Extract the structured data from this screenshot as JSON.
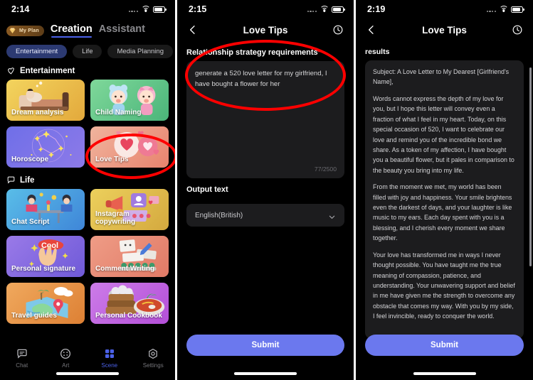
{
  "panel1": {
    "status": {
      "time": "2:14",
      "wifi_icon": "wifi-icon",
      "battery_icon": "battery-icon",
      "signal_icon": "signal-dots-icon"
    },
    "plan_badge": {
      "label": "My Plan",
      "icon": "gem-icon",
      "color": "#8a5a22"
    },
    "nav_tabs": [
      {
        "label": "Creation",
        "active": true
      },
      {
        "label": "Assistant",
        "active": false
      }
    ],
    "pills": [
      {
        "label": "Entertainment",
        "active": true,
        "color": "#2c3a72"
      },
      {
        "label": "Life",
        "active": false
      },
      {
        "label": "Media Planning",
        "active": false
      }
    ],
    "sections": [
      {
        "title": "Entertainment",
        "icon": "heart-outline-icon",
        "cards": [
          {
            "label": "Dream analysis",
            "color": "#e8c84a",
            "art": "sleeping-person-bed-icon"
          },
          {
            "label": "Child Naming",
            "color": "#6bc98a",
            "art": "two-babies-icon"
          },
          {
            "label": "Horoscope",
            "color": "#6b6de0",
            "art": "constellation-icon"
          },
          {
            "label": "Love Tips",
            "color": "#ef9a86",
            "art": "heart-bubbles-icon"
          }
        ]
      },
      {
        "title": "Life",
        "icon": "speech-bubble-icon",
        "cards": [
          {
            "label": "Chat Script",
            "color": "#4aa8dd",
            "art": "two-people-table-icon"
          },
          {
            "label": "Instagram copywriting",
            "color": "#e0c34a",
            "art": "megaphone-social-icon"
          },
          {
            "label": "Personal signature",
            "color": "#8a6be0",
            "art": "cool-hand-icon"
          },
          {
            "label": "Comment Writing",
            "color": "#e08b7a",
            "art": "cards-pen-icon"
          },
          {
            "label": "Travel guides",
            "color": "#e59a4e",
            "art": "map-island-icon"
          },
          {
            "label": "Personal Cookbook",
            "color": "#c06ce0",
            "art": "food-bowls-icon"
          }
        ]
      }
    ],
    "tabbar": [
      {
        "label": "Chat",
        "icon": "chat-icon",
        "active": false
      },
      {
        "label": "Art",
        "icon": "palette-icon",
        "active": false
      },
      {
        "label": "Scene",
        "icon": "grid-squares-icon",
        "active": true
      },
      {
        "label": "Settings",
        "icon": "gear-icon",
        "active": false
      }
    ],
    "accent_color": "#4b61e8"
  },
  "panel2": {
    "status": {
      "time": "2:15"
    },
    "header": {
      "title": "Love Tips",
      "back_icon": "chevron-left-icon",
      "history_icon": "clock-icon"
    },
    "form": {
      "field_label": "Relationship strategy requirements",
      "required_marker": "*",
      "input_value": "generate a 520 love letter for my girlfriend, I have bought a flower for her",
      "counter": "77/2500",
      "output_label": "Output text",
      "language_value": "English(British)",
      "dropdown_icon": "chevron-down-icon"
    },
    "submit_label": "Submit",
    "submit_color": "#6b78ee"
  },
  "panel3": {
    "status": {
      "time": "2:19"
    },
    "header": {
      "title": "Love Tips",
      "back_icon": "chevron-left-icon",
      "history_icon": "clock-icon"
    },
    "results_label": "results",
    "result_paragraphs": [
      "Subject: A Love Letter to My Dearest [Girlfriend's Name],",
      "Words cannot express the depth of my love for you, but I hope this letter will convey even a fraction of what I feel in my heart. Today, on this special occasion of 520, I want to celebrate our love and remind you of the incredible bond we share. As a token of my affection, I have bought you a beautiful flower, but it pales in comparison to the beauty you bring into my life.",
      "From the moment we met, my world has been filled with joy and happiness. Your smile brightens even the darkest of days, and your laughter is like music to my ears. Each day spent with you is a blessing, and I cherish every moment we share together.",
      "Your love has transformed me in ways I never thought possible. You have taught me the true meaning of compassion, patience, and understanding. Your unwavering support and belief in me have given me the strength to overcome any obstacle that comes my way. With you by my side, I feel invincible, ready to conquer the world."
    ],
    "submit_label": "Submit"
  },
  "annotations": {
    "highlight_color": "#ff0000"
  }
}
